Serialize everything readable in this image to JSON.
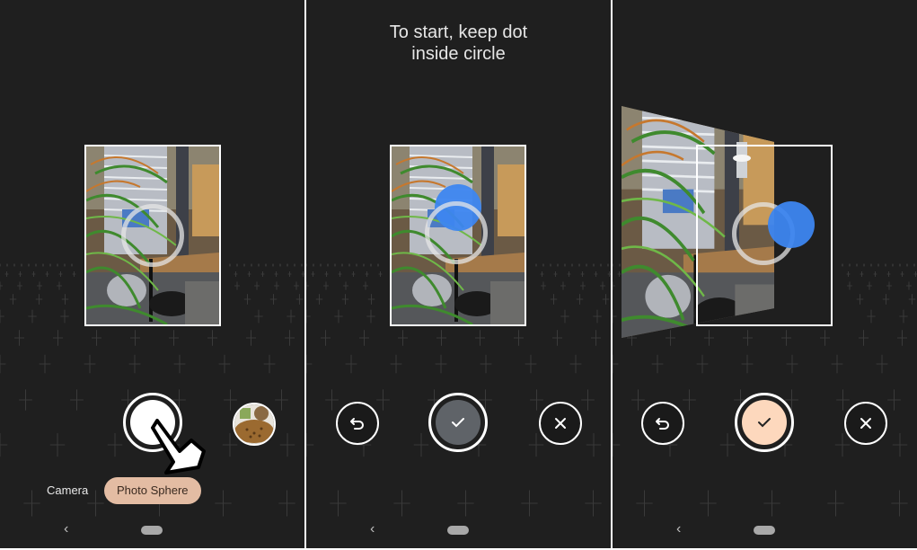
{
  "panels": [
    {
      "id": "step-1",
      "state": "ready",
      "modes": [
        {
          "label": "Camera",
          "active": false
        },
        {
          "label": "Photo Sphere",
          "active": true
        }
      ],
      "icons": {
        "shutter": "shutter-button",
        "pointer": "hand-pointer-icon",
        "thumbnail": "gallery-thumbnail",
        "back": "nav-back-icon",
        "home": "nav-home-pill"
      },
      "nav": {
        "back_glyph": "‹"
      }
    },
    {
      "id": "step-2",
      "state": "aligning",
      "prompt_line1": "To start, keep dot",
      "prompt_line2": "inside circle",
      "buttons": {
        "undo": "undo-icon",
        "done": "check-icon",
        "cancel": "close-icon"
      },
      "done_button_color": "#5f6368",
      "nav": {
        "back_glyph": "‹"
      }
    },
    {
      "id": "step-3",
      "state": "capturing",
      "buttons": {
        "undo": "undo-icon",
        "done": "check-icon",
        "cancel": "close-icon"
      },
      "done_button_color": "#fdd8bd",
      "nav": {
        "back_glyph": "‹"
      }
    }
  ],
  "colors": {
    "background": "#1f1f1f",
    "accent_chip": "#e3bca3",
    "dot_blue": "#3d86f0"
  }
}
